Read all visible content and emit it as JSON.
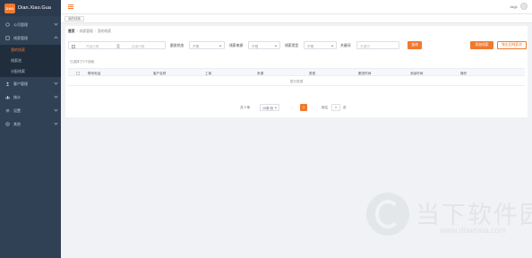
{
  "app": {
    "logo_badge": "DXG",
    "logo_text": "Dian.Xiao.Gua"
  },
  "sidebar": {
    "items": [
      {
        "label": "公司管理",
        "icon": "building-icon",
        "expanded": false
      },
      {
        "label": "线索管理",
        "icon": "clue-icon",
        "expanded": true,
        "children": [
          {
            "label": "我的线索",
            "active": true
          },
          {
            "label": "线索池",
            "active": false
          },
          {
            "label": "分配线索",
            "active": false
          }
        ]
      },
      {
        "label": "客户管理",
        "icon": "user-icon",
        "expanded": false
      },
      {
        "label": "统计",
        "icon": "chart-icon",
        "expanded": false
      },
      {
        "label": "设置",
        "icon": "gear-icon",
        "expanded": false
      },
      {
        "label": "其他",
        "icon": "more-icon",
        "expanded": false
      }
    ]
  },
  "header": {
    "user": "dxg1"
  },
  "tags": {
    "current": "我的线索"
  },
  "breadcrumb": {
    "root": "首页",
    "level2": "线索管理",
    "level3": "我的线索",
    "sep": "/"
  },
  "filters": {
    "start_placeholder": "开始日期",
    "range_sep": "至",
    "end_placeholder": "结束日期",
    "follow_label": "跟进状态",
    "follow_value": "不限",
    "source_label": "线索来源",
    "source_value": "不限",
    "type_label": "线索类型",
    "type_value": "不限",
    "keyword_label": "关键词",
    "keyword_placeholder": "关键词",
    "search_btn": "查询",
    "add_btn": "添加线索",
    "move_btn": "移出回线索池"
  },
  "selected_info": "已选择了0个线索",
  "table": {
    "columns": [
      "联系电话",
      "客户名称",
      "工商",
      "来源",
      "类型",
      "跟进时间",
      "添加时间",
      "操作"
    ],
    "empty_text": "暂无数据"
  },
  "pagination": {
    "total": "共 0 条",
    "page_size": "10条/页",
    "prev": "‹",
    "current": "1",
    "next": "›",
    "goto_label": "前往",
    "goto_value": "1",
    "page_suffix": "页"
  },
  "watermark": {
    "text": "当下软件园",
    "url": "www.downxia.com"
  },
  "colors": {
    "accent": "#f0792e",
    "sidebar_bg": "#304156"
  }
}
